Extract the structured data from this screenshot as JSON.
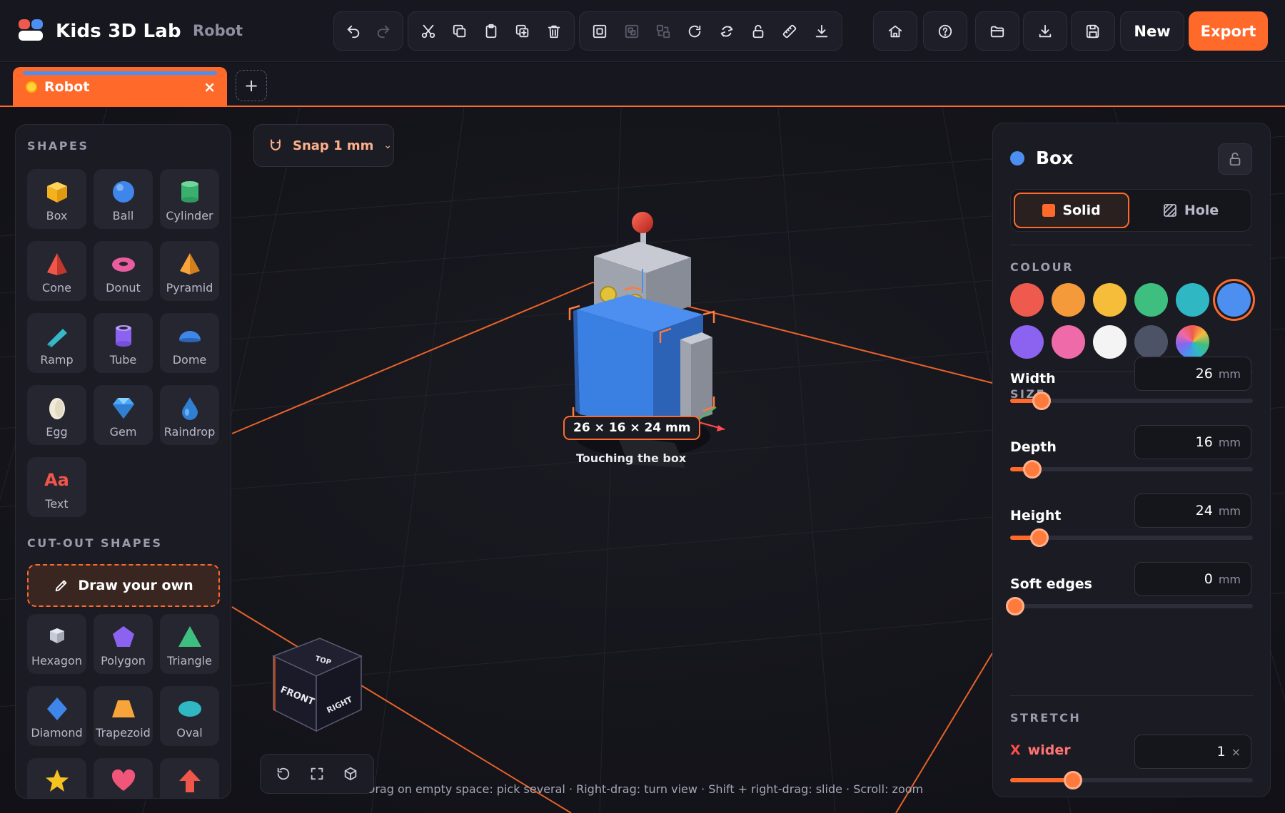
{
  "app": {
    "title": "Kids 3D Lab",
    "project": "Robot"
  },
  "toolbar": {
    "edit_icons": [
      "undo-icon",
      "redo-icon"
    ],
    "clip_icons": [
      "cut-icon",
      "copy-icon",
      "paste-icon",
      "duplicate-icon",
      "delete-icon"
    ],
    "arrange_icons": [
      "group-icon",
      "ungroup-icon",
      "align-icon",
      "rotate-icon",
      "flip-icon",
      "unlock-icon",
      "ruler-icon",
      "drop-to-floor-icon"
    ],
    "file_icons": [
      "home-icon",
      "help-icon",
      "open-folder-icon",
      "import-icon",
      "save-icon"
    ],
    "new_label": "New",
    "export_label": "Export"
  },
  "tabs": [
    {
      "label": "Robot",
      "close": "×"
    }
  ],
  "tab_add": "+",
  "snap": {
    "label": "Snap 1 mm"
  },
  "viewport": {
    "dims": "26 × 16 × 24 mm",
    "note": "Touching the box",
    "hint": "Drag on empty space: pick several · Right-drag: turn view · Shift + right-drag: slide · Scroll: zoom",
    "viewcube": {
      "top": "TOP",
      "front": "FRONT",
      "right": "RIGHT"
    }
  },
  "left_panel": {
    "shapes_title": "SHAPES",
    "shapes": [
      {
        "label": "Box",
        "icon": "box-icon"
      },
      {
        "label": "Ball",
        "icon": "ball-icon"
      },
      {
        "label": "Cylinder",
        "icon": "cylinder-icon"
      },
      {
        "label": "Cone",
        "icon": "cone-icon"
      },
      {
        "label": "Donut",
        "icon": "donut-icon"
      },
      {
        "label": "Pyramid",
        "icon": "pyramid-icon"
      },
      {
        "label": "Ramp",
        "icon": "ramp-icon"
      },
      {
        "label": "Tube",
        "icon": "tube-icon"
      },
      {
        "label": "Dome",
        "icon": "dome-icon"
      },
      {
        "label": "Egg",
        "icon": "egg-icon"
      },
      {
        "label": "Gem",
        "icon": "gem-icon"
      },
      {
        "label": "Raindrop",
        "icon": "raindrop-icon"
      },
      {
        "label": "Text",
        "icon": "text-icon",
        "glyph": "Aa"
      }
    ],
    "cutout_title": "CUT-OUT SHAPES",
    "draw_label": "Draw your own",
    "cutouts": [
      {
        "label": "Hexagon",
        "icon": "hexagon-icon"
      },
      {
        "label": "Polygon",
        "icon": "polygon-icon"
      },
      {
        "label": "Triangle",
        "icon": "triangle-icon"
      },
      {
        "label": "Diamond",
        "icon": "diamond-icon"
      },
      {
        "label": "Trapezoid",
        "icon": "trapezoid-icon"
      },
      {
        "label": "Oval",
        "icon": "oval-icon"
      },
      {
        "label": "",
        "icon": "star-icon"
      },
      {
        "label": "",
        "icon": "heart-icon"
      },
      {
        "label": "",
        "icon": "arrow-icon"
      }
    ]
  },
  "right_panel": {
    "title": "Box",
    "mode": {
      "solid": "Solid",
      "hole": "Hole",
      "selected": "solid"
    },
    "colour_title": "COLOUR",
    "colours": [
      "#ef5a4f",
      "#f59a3a",
      "#f5bd3a",
      "#3fbf7f",
      "#2fb8c4",
      "#4d8ff0",
      "#8b63f0",
      "#ef6aa8",
      "#f4f4f4",
      "#4d5366",
      "rainbow"
    ],
    "selected_colour": 5,
    "size_title": "SIZE",
    "props": [
      {
        "label": "Width",
        "value": "26",
        "unit": "mm",
        "level": 0.13
      },
      {
        "label": "Depth",
        "value": "16",
        "unit": "mm",
        "level": 0.09
      },
      {
        "label": "Height",
        "value": "24",
        "unit": "mm",
        "level": 0.12
      },
      {
        "label": "Soft edges",
        "value": "0",
        "unit": "mm",
        "level": 0.0
      }
    ],
    "stretch_title": "STRETCH",
    "stretch": {
      "axis": "X",
      "label": "wider",
      "value": "1",
      "unit": "×",
      "level": 0.26
    }
  }
}
